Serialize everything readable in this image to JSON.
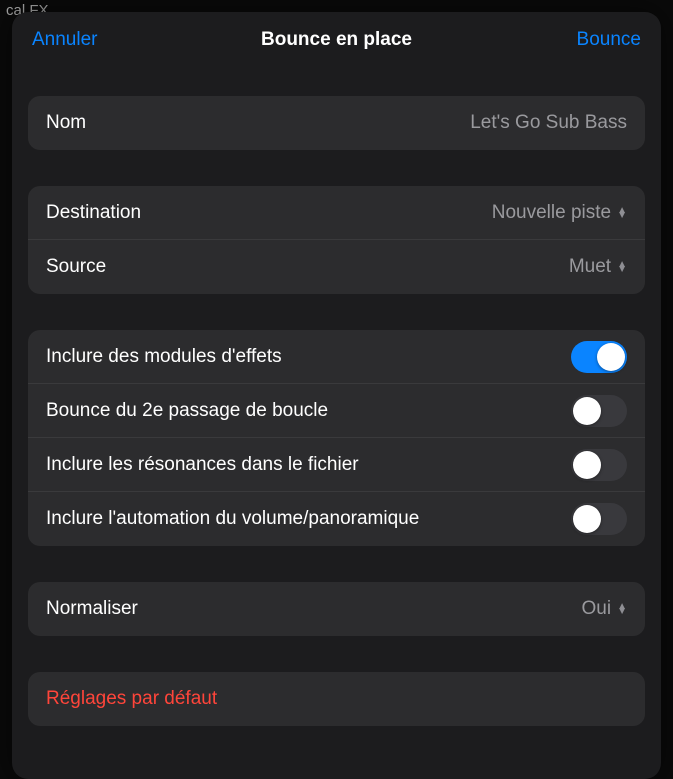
{
  "bg_hint": "cal FX",
  "nav": {
    "cancel": "Annuler",
    "title": "Bounce en place",
    "confirm": "Bounce"
  },
  "name": {
    "label": "Nom",
    "value": "Let's Go Sub Bass"
  },
  "destination": {
    "label": "Destination",
    "value": "Nouvelle piste"
  },
  "source": {
    "label": "Source",
    "value": "Muet"
  },
  "toggles": {
    "effects": {
      "label": "Inclure des modules d'effets",
      "on": true
    },
    "second_pass": {
      "label": "Bounce du 2e passage de boucle",
      "on": false
    },
    "tail": {
      "label": "Inclure les résonances dans le fichier",
      "on": false
    },
    "automation": {
      "label": "Inclure l'automation du volume/panoramique",
      "on": false
    }
  },
  "normalize": {
    "label": "Normaliser",
    "value": "Oui"
  },
  "reset": "Réglages par défaut"
}
